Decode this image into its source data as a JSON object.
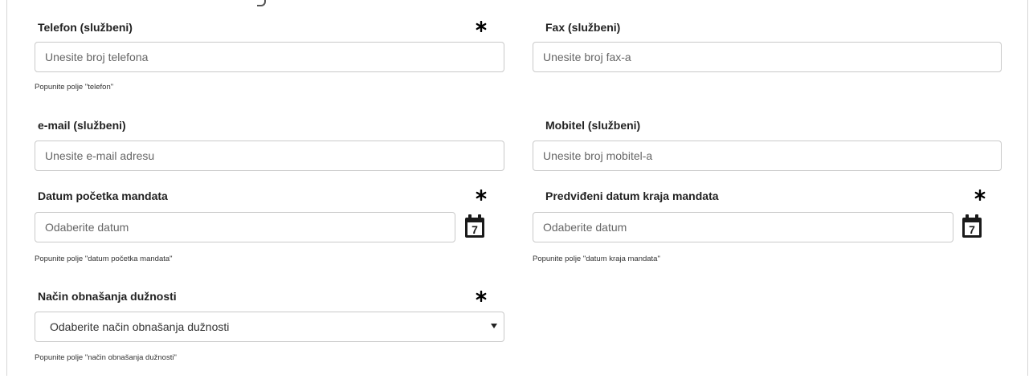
{
  "fields": {
    "telefon": {
      "label": "Telefon (službeni)",
      "placeholder": "Unesite broj telefona",
      "hint": "Popunite polje \"telefon\""
    },
    "fax": {
      "label": "Fax (službeni)",
      "placeholder": "Unesite broj fax-a"
    },
    "email": {
      "label": "e-mail (službeni)",
      "placeholder": "Unesite e-mail adresu"
    },
    "mobitel": {
      "label": "Mobitel (službeni)",
      "placeholder": "Unesite broj mobitel-a"
    },
    "datum_pocetka": {
      "label": "Datum početka mandata",
      "placeholder": "Odaberite datum",
      "hint": "Popunite polje \"datum početka mandata\"",
      "calendar_day": "7"
    },
    "datum_kraja": {
      "label": "Predviđeni datum kraja mandata",
      "placeholder": "Odaberite datum",
      "hint": "Popunite polje \"datum kraja mandata\"",
      "calendar_day": "7"
    },
    "nacin": {
      "label": "Način obnašanja dužnosti",
      "selected": "Odaberite način obnašanja dužnosti",
      "hint": "Popunite polje \"način obnašanja dužnosti\""
    }
  },
  "icons": {
    "required": "asterisk-icon",
    "calendar": "calendar-icon",
    "dropdown": "chevron-down-icon"
  }
}
